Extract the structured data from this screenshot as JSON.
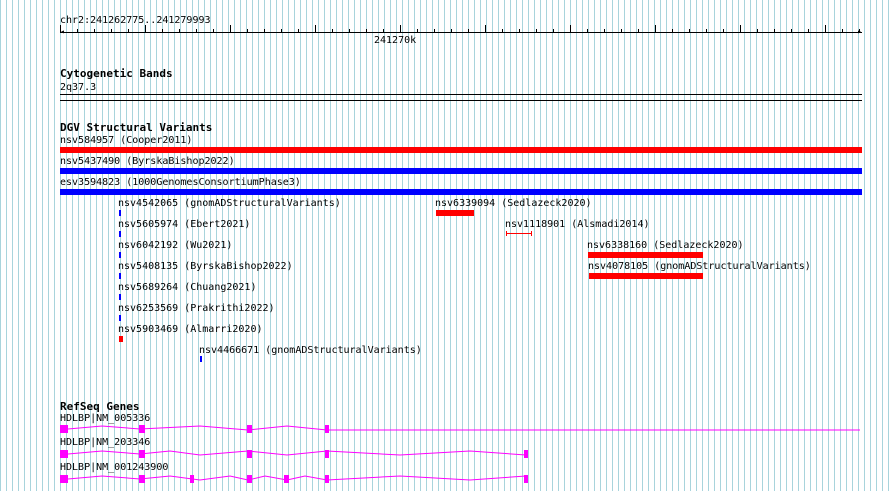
{
  "locus": "chr2:241262775..241279993",
  "ruler": {
    "label": "241270k"
  },
  "cytoband": {
    "title": "Cytogenetic Bands",
    "band": "2q37.3"
  },
  "dgv": {
    "title": "DGV Structural Variants",
    "variants": [
      {
        "label": "nsv584957 (Cooper2011)",
        "color": "#ff0000"
      },
      {
        "label": "nsv5437490 (ByrskaBishop2022)",
        "color": "#0000ff"
      },
      {
        "label": "esv3594823 (1000GenomesConsortiumPhase3)",
        "color": "#0000ff"
      },
      {
        "label": "nsv4542065 (gnomADStructuralVariants)",
        "color": "#0000ff"
      },
      {
        "label": "nsv6339094 (Sedlazeck2020)",
        "color": "#ff0000"
      },
      {
        "label": "nsv5605974 (Ebert2021)",
        "color": "#0000ff"
      },
      {
        "label": "nsv1118901 (Alsmadi2014)",
        "color": "#ff0000"
      },
      {
        "label": "nsv6042192 (Wu2021)",
        "color": "#0000ff"
      },
      {
        "label": "nsv6338160 (Sedlazeck2020)",
        "color": "#ff0000"
      },
      {
        "label": "nsv5408135 (ByrskaBishop2022)",
        "color": "#0000ff"
      },
      {
        "label": "nsv4078105 (gnomADStructuralVariants)",
        "color": "#ff0000"
      },
      {
        "label": "nsv5689264 (Chuang2021)",
        "color": "#0000ff"
      },
      {
        "label": "nsv6253569 (Prakrithi2022)",
        "color": "#0000ff"
      },
      {
        "label": "nsv5903469 (Almarri2020)",
        "color": "#ff0000"
      },
      {
        "label": "nsv4466671 (gnomADStructuralVariants)",
        "color": "#0000ff"
      }
    ]
  },
  "refseq": {
    "title": "RefSeq Genes",
    "color": "#ff00ff",
    "transcripts": [
      {
        "label": "HDLBP|NM_005336"
      },
      {
        "label": "HDLBP|NM_203346"
      },
      {
        "label": "HDLBP|NM_001243900"
      }
    ]
  }
}
